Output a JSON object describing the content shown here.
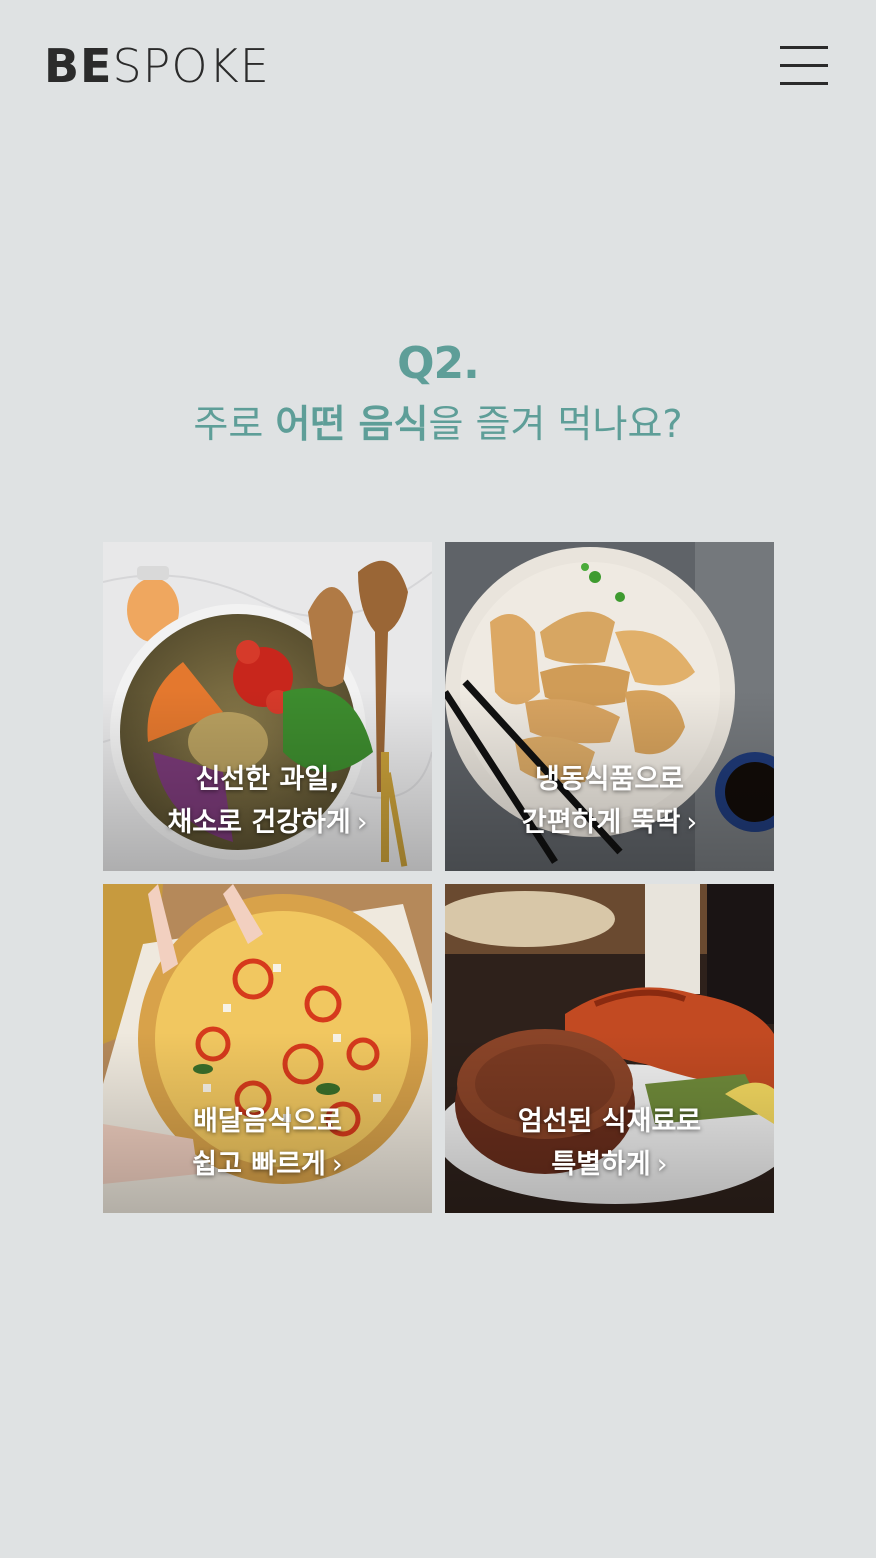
{
  "header": {
    "logo_bold": "BE",
    "logo_light": "SPOKE",
    "menu_icon": "hamburger-menu-icon"
  },
  "question": {
    "number": "Q2.",
    "text_pre": "주로 ",
    "text_bold": "어떤 음식",
    "text_post": "을 즐겨 먹나요?",
    "color": "#5e9e98"
  },
  "options": [
    {
      "line1": "신선한 과일,",
      "line2": "채소로 건강하게",
      "chevron": "›",
      "image": "salad-photo"
    },
    {
      "line1": "냉동식품으로",
      "line2": "간편하게 뚝딱",
      "chevron": "›",
      "image": "dumplings-photo"
    },
    {
      "line1": "배달음식으로",
      "line2": "쉽고 빠르게",
      "chevron": "›",
      "image": "pizza-photo"
    },
    {
      "line1": "엄선된 식재료로",
      "line2": "특별하게",
      "chevron": "›",
      "image": "steak-lobster-photo"
    }
  ]
}
